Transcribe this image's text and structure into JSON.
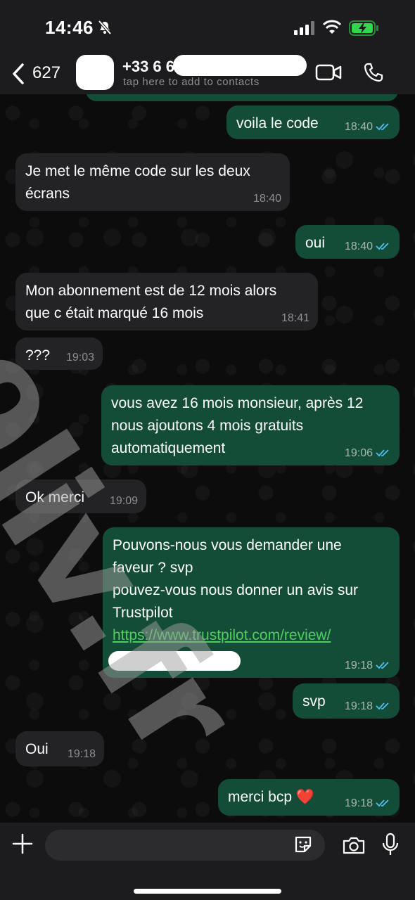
{
  "status_bar": {
    "time": "14:46"
  },
  "header": {
    "back_count": "627",
    "contact_name": "+33 6 6",
    "contact_subtitle": "tap here to add to contacts"
  },
  "messages": [
    {
      "direction": "out",
      "text": "voila le code",
      "time": "18:40",
      "read": true
    },
    {
      "direction": "in",
      "text": "Je met le même code sur les deux\nécrans",
      "time": "18:40"
    },
    {
      "direction": "out",
      "text": "oui",
      "time": "18:40",
      "read": true
    },
    {
      "direction": "in",
      "text": "Mon abonnement est de 12 mois alors\nque c était marqué 16 mois",
      "time": "18:41"
    },
    {
      "direction": "in",
      "text": "???",
      "time": "19:03"
    },
    {
      "direction": "out",
      "text": "vous avez 16 mois monsieur, après 12\nnous ajoutons 4 mois gratuits\nautomatiquement",
      "time": "19:06",
      "read": true
    },
    {
      "direction": "in",
      "text": "Ok merci",
      "time": "19:09"
    },
    {
      "direction": "out",
      "text": "Pouvons-nous vous demander une\nfaveur ? svp\npouvez-vous nous donner un avis sur\nTrustpilot",
      "link": "https://www.trustpilot.com/review/",
      "time": "19:18",
      "read": true
    },
    {
      "direction": "out",
      "text": "svp",
      "time": "19:18",
      "read": true
    },
    {
      "direction": "in",
      "text": "Oui",
      "time": "19:18"
    },
    {
      "direction": "out",
      "text": "merci bcp",
      "emoji": "❤️",
      "time": "19:18",
      "read": true
    }
  ],
  "watermark": "9liv.fr",
  "colors": {
    "outgoing_bubble": "#144d37",
    "incoming_bubble": "#232325",
    "read_ticks": "#53bdeb",
    "link": "#4fce5d"
  },
  "icons": [
    "chevron-left-icon",
    "video-camera-icon",
    "phone-icon",
    "plus-icon",
    "sticker-icon",
    "camera-icon",
    "microphone-icon",
    "muted-bell-icon",
    "signal-icon",
    "wifi-icon",
    "battery-charging-icon"
  ]
}
